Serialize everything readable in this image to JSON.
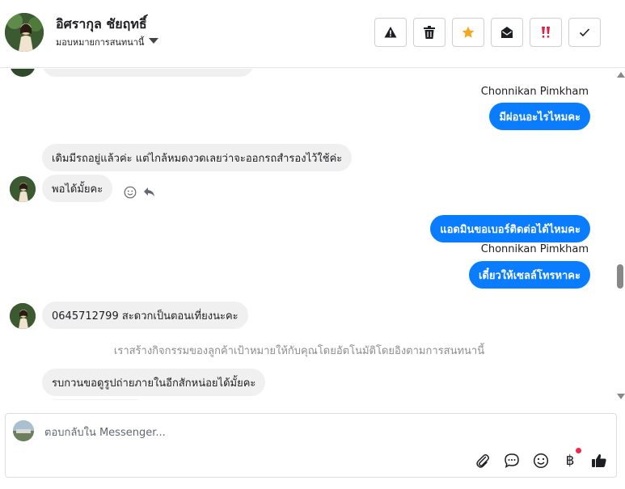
{
  "header": {
    "contact_name": "อิศรากุล ชัยฤทธิ์",
    "assign_label": "มอบหมายการสนทนานี้",
    "toolbar": [
      {
        "name": "spam-button",
        "icon": "warning-icon"
      },
      {
        "name": "delete-button",
        "icon": "trash-icon"
      },
      {
        "name": "star-button",
        "icon": "star-icon",
        "color": "#f5a623"
      },
      {
        "name": "mark-unread-button",
        "icon": "envelope-open-icon"
      },
      {
        "name": "priority-button",
        "icon": "double-exclamation-icon",
        "color": "#e41e3f"
      },
      {
        "name": "done-button",
        "icon": "check-icon"
      }
    ]
  },
  "messages": {
    "out1_sender": "Chonnikan Pimkham",
    "out1_text": "มีผ่อนอะไรไหมคะ",
    "in1_text": "เดิมมีรถอยู่แล้วค่ะ แต่ไกล้หมดงวดเลยว่าจะออกรถสำรองไว้ใช้ค่ะ",
    "in2_text": "พอได้มั้ยคะ",
    "out2_text": "แอดมินขอเบอร์ติดต่อได้ไหมคะ",
    "out3_sender": "Chonnikan Pimkham",
    "out3_text": "เดี๋ยวให้เซลล์โทรหาคะ",
    "in3_text": "0645712799 สะดวกเป็นตอนเที่ยงนะคะ",
    "system_note": "เราสร้างกิจกรรมของลูกค้าเป้าหมายให้กับคุณโดยอัตโนมัติโดยอิงตามการสนทนานี้",
    "in4_text": "รบกวนขอดูรูปถ่ายภายในอีกสักหน่อยได้มั้ยคะ"
  },
  "composer": {
    "placeholder": "ตอบกลับใน Messenger...",
    "currency_symbol": "฿",
    "brand_color": "#0a7cff"
  }
}
